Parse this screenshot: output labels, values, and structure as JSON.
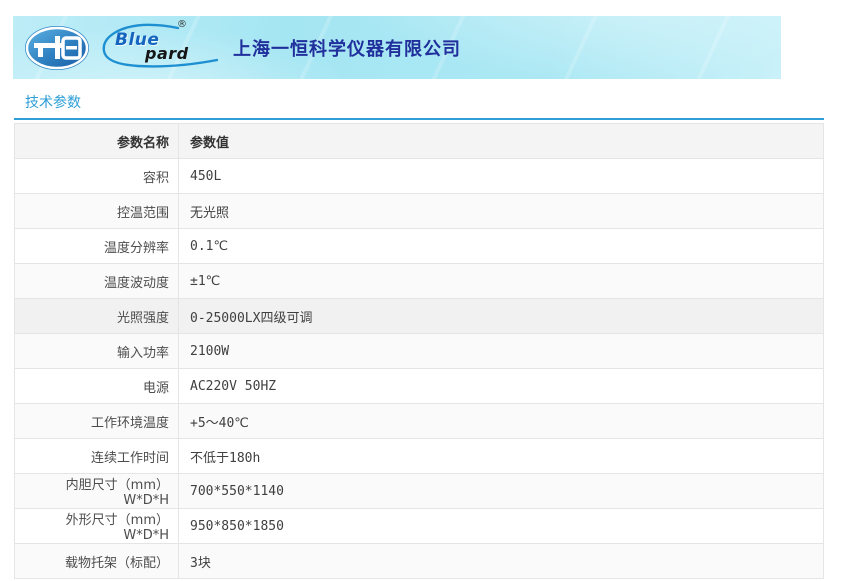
{
  "banner": {
    "company_name": "上海一恒科学仪器有限公司",
    "brand": {
      "blue": "Blue",
      "pard": "pard",
      "registered_mark": "®"
    },
    "colors": {
      "background": "#a6e7f3",
      "company_text": "#202f9c",
      "swoosh": "#1e8fd0",
      "oval_fill": "#2e7fc0"
    }
  },
  "section": {
    "title": "技术参数",
    "accent_color": "#2e9fd6"
  },
  "table": {
    "headers": [
      "参数名称",
      "参数值"
    ],
    "rows": [
      {
        "name": "容积",
        "value": "450L",
        "highlight": false
      },
      {
        "name": "控温范围",
        "value": "无光照",
        "highlight": false
      },
      {
        "name": "温度分辨率",
        "value": "0.1℃",
        "highlight": false
      },
      {
        "name": "温度波动度",
        "value": "±1℃",
        "highlight": false
      },
      {
        "name": "光照强度",
        "value": "0-25000LX四级可调",
        "highlight": true
      },
      {
        "name": "输入功率",
        "value": "2100W",
        "highlight": false
      },
      {
        "name": "电源",
        "value": "AC220V 50HZ",
        "highlight": false
      },
      {
        "name": "工作环境温度",
        "value": "+5～40℃",
        "highlight": false
      },
      {
        "name": "连续工作时间",
        "value": "不低于180h",
        "highlight": false
      },
      {
        "name": "内胆尺寸（mm）W*D*H",
        "value": "700*550*1140",
        "highlight": false
      },
      {
        "name": "外形尺寸（mm）W*D*H",
        "value": "950*850*1850",
        "highlight": false
      },
      {
        "name": "载物托架（标配）",
        "value": "3块",
        "highlight": false
      }
    ],
    "colors": {
      "header_bg": "#f4f4f4",
      "stripe_bg": "#fafafa",
      "highlight_bg": "#f1f1f1",
      "border": "#e5e5e5"
    }
  }
}
